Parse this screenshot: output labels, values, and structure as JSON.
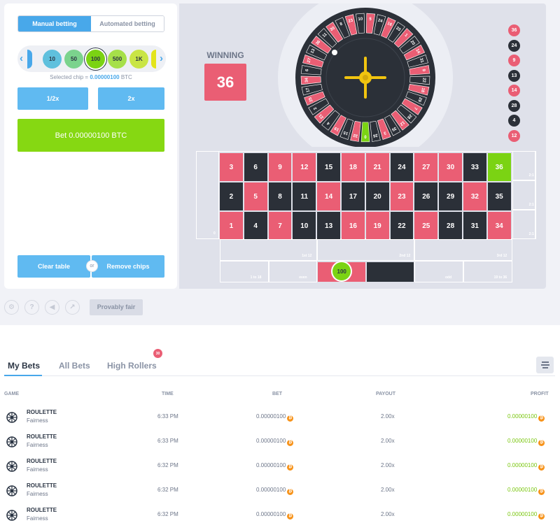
{
  "controls": {
    "mode_tabs": [
      "Manual betting",
      "Automated betting"
    ],
    "chips": [
      "10",
      "50",
      "100",
      "500",
      "1K"
    ],
    "selected_chip_label": "Selected chip = ",
    "selected_chip_value": "0.00000100",
    "selected_chip_unit": "BTC",
    "half_label": "1/2x",
    "double_label": "2x",
    "bet_label": "Bet 0.00000100 BTC",
    "clear_label": "Clear table",
    "or_label": "or",
    "remove_label": "Remove chips",
    "provably_fair": "Provably fair"
  },
  "result": {
    "winning_label": "WINNING",
    "winning_number": "36",
    "history": [
      {
        "n": "36",
        "c": "red"
      },
      {
        "n": "24",
        "c": "black"
      },
      {
        "n": "9",
        "c": "red"
      },
      {
        "n": "13",
        "c": "black"
      },
      {
        "n": "14",
        "c": "red"
      },
      {
        "n": "28",
        "c": "black"
      },
      {
        "n": "4",
        "c": "black"
      },
      {
        "n": "12",
        "c": "red"
      }
    ]
  },
  "wheel": {
    "visible_labels": [
      "0",
      "32",
      "15",
      "19",
      "4",
      "21",
      "2",
      "25",
      "17",
      "34",
      "6",
      "27",
      "13",
      "36",
      "11",
      "30",
      "8",
      "23",
      "10",
      "5",
      "24",
      "16",
      "33",
      "1",
      "20",
      "14",
      "31",
      "9",
      "22",
      "18",
      "29",
      "7",
      "28",
      "12",
      "35",
      "3",
      "26"
    ]
  },
  "board": {
    "rows": [
      [
        "3",
        "6",
        "9",
        "12",
        "15",
        "18",
        "21",
        "24",
        "27",
        "30",
        "33",
        "36"
      ],
      [
        "2",
        "5",
        "8",
        "11",
        "14",
        "17",
        "20",
        "23",
        "26",
        "29",
        "32",
        "35"
      ],
      [
        "1",
        "4",
        "7",
        "10",
        "13",
        "16",
        "19",
        "22",
        "25",
        "28",
        "31",
        "34"
      ]
    ],
    "red_numbers": [
      "1",
      "3",
      "5",
      "7",
      "9",
      "12",
      "14",
      "16",
      "18",
      "19",
      "21",
      "23",
      "25",
      "27",
      "30",
      "32",
      "34",
      "36"
    ],
    "highlight": "36",
    "zero": "0",
    "col_labels": [
      "2:1",
      "2:1",
      "2:1"
    ],
    "dozens": [
      "1st 12",
      "2nd 12",
      "3rd 12"
    ],
    "outside": [
      "1 to 18",
      "even",
      "",
      "",
      "odd",
      "19 to 36"
    ],
    "placed_chip": "100",
    "colors": {
      "red": "#ea5e74",
      "black": "#2b3038",
      "green": "#7bd313"
    }
  },
  "bets": {
    "tabs": [
      "My Bets",
      "All Bets",
      "High Rollers"
    ],
    "high_rollers_badge": "30",
    "headers": [
      "GAME",
      "TIME",
      "BET",
      "PAYOUT",
      "PROFIT"
    ],
    "rows": [
      {
        "game": "ROULETTE",
        "sub": "Fairness",
        "time": "6:33 PM",
        "bet": "0.00000100",
        "payout": "2.00x",
        "profit": "0.00000100"
      },
      {
        "game": "ROULETTE",
        "sub": "Fairness",
        "time": "6:33 PM",
        "bet": "0.00000100",
        "payout": "2.00x",
        "profit": "0.00000100"
      },
      {
        "game": "ROULETTE",
        "sub": "Fairness",
        "time": "6:32 PM",
        "bet": "0.00000100",
        "payout": "2.00x",
        "profit": "0.00000100"
      },
      {
        "game": "ROULETTE",
        "sub": "Fairness",
        "time": "6:32 PM",
        "bet": "0.00000100",
        "payout": "2.00x",
        "profit": "0.00000100"
      },
      {
        "game": "ROULETTE",
        "sub": "Fairness",
        "time": "6:32 PM",
        "bet": "0.00000100",
        "payout": "2.00x",
        "profit": "0.00000100"
      }
    ]
  }
}
